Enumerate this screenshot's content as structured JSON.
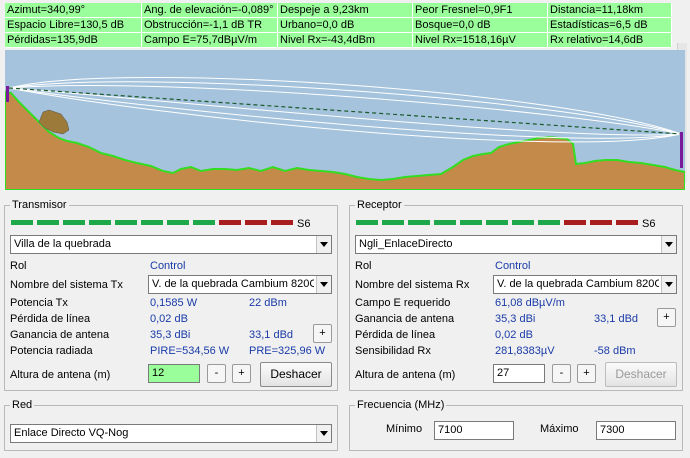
{
  "info": [
    [
      "Azimut=340,99°",
      "Ang. de elevación=-0,089°",
      "Despeje a 9,23km",
      "Peor Fresnel=0,9F1",
      "Distancia=11,18km"
    ],
    [
      "Espacio Libre=130,5 dB",
      "Obstrucción=-1,1 dB TR",
      "Urbano=0,0 dB",
      "Bosque=0,0 dB",
      "Estadísticas=6,5 dB"
    ],
    [
      "Pérdidas=135,9dB",
      "Campo E=75,7dBµV/m",
      "Nivel Rx=-43,4dBm",
      "Nivel Rx=1518,16µV",
      "Rx relativo=14,6dB"
    ]
  ],
  "colors": {
    "terrain": "#c48a4a",
    "terrain_edge": "#33dd22",
    "sky": "#a5c3dc",
    "info_bg": "#9aff9a",
    "value_text": "#1a3ba8",
    "signal_green": "#1fa84a",
    "signal_red": "#a81e1e"
  },
  "transmitter": {
    "title": "Transmisor",
    "signal_label": "S6",
    "station": "Villa de la quebrada",
    "rol_label": "Rol",
    "rol_value": "Control",
    "system_label": "Nombre del sistema Tx",
    "system_value": "V. de la quebrada Cambium 820C",
    "power_label": "Potencia Tx",
    "power_w": "0,1585 W",
    "power_dbm": "22 dBm",
    "line_loss_label": "Pérdida de línea",
    "line_loss": "0,02 dB",
    "gain_label": "Ganancia de antena",
    "gain_dbi": "35,3 dBi",
    "gain_dbd": "33,1 dBd",
    "radiated_label": "Potencia radiada",
    "pire": "PIRE=534,56 W",
    "pre": "PRE=325,96 W",
    "height_label": "Altura de antena (m)",
    "height_value": "12",
    "minus": "-",
    "plus": "+",
    "undo": "Deshacer"
  },
  "receiver": {
    "title": "Receptor",
    "signal_label": "S6",
    "station": "Ngli_EnlaceDirecto",
    "rol_label": "Rol",
    "rol_value": "Control",
    "system_label": "Nombre del sistema Rx",
    "system_value": "V. de la quebrada Cambium 820C",
    "efield_label": "Campo E requerido",
    "efield_value": "61,08 dBµV/m",
    "gain_label": "Ganancia de antena",
    "gain_dbi": "35,3 dBi",
    "gain_dbd": "33,1 dBd",
    "line_loss_label": "Pérdida de línea",
    "line_loss": "0,02 dB",
    "sens_label": "Sensibilidad Rx",
    "sens_uv": "281,8383µV",
    "sens_dbm": "-58 dBm",
    "height_label": "Altura de antena (m)",
    "height_value": "27",
    "minus": "-",
    "plus": "+",
    "undo": "Deshacer"
  },
  "network": {
    "title": "Red",
    "value": "Enlace Directo VQ-Nog"
  },
  "frequency": {
    "title": "Frecuencia (MHz)",
    "min_label": "Mínimo",
    "min_value": "7100",
    "max_label": "Máximo",
    "max_value": "7300"
  }
}
